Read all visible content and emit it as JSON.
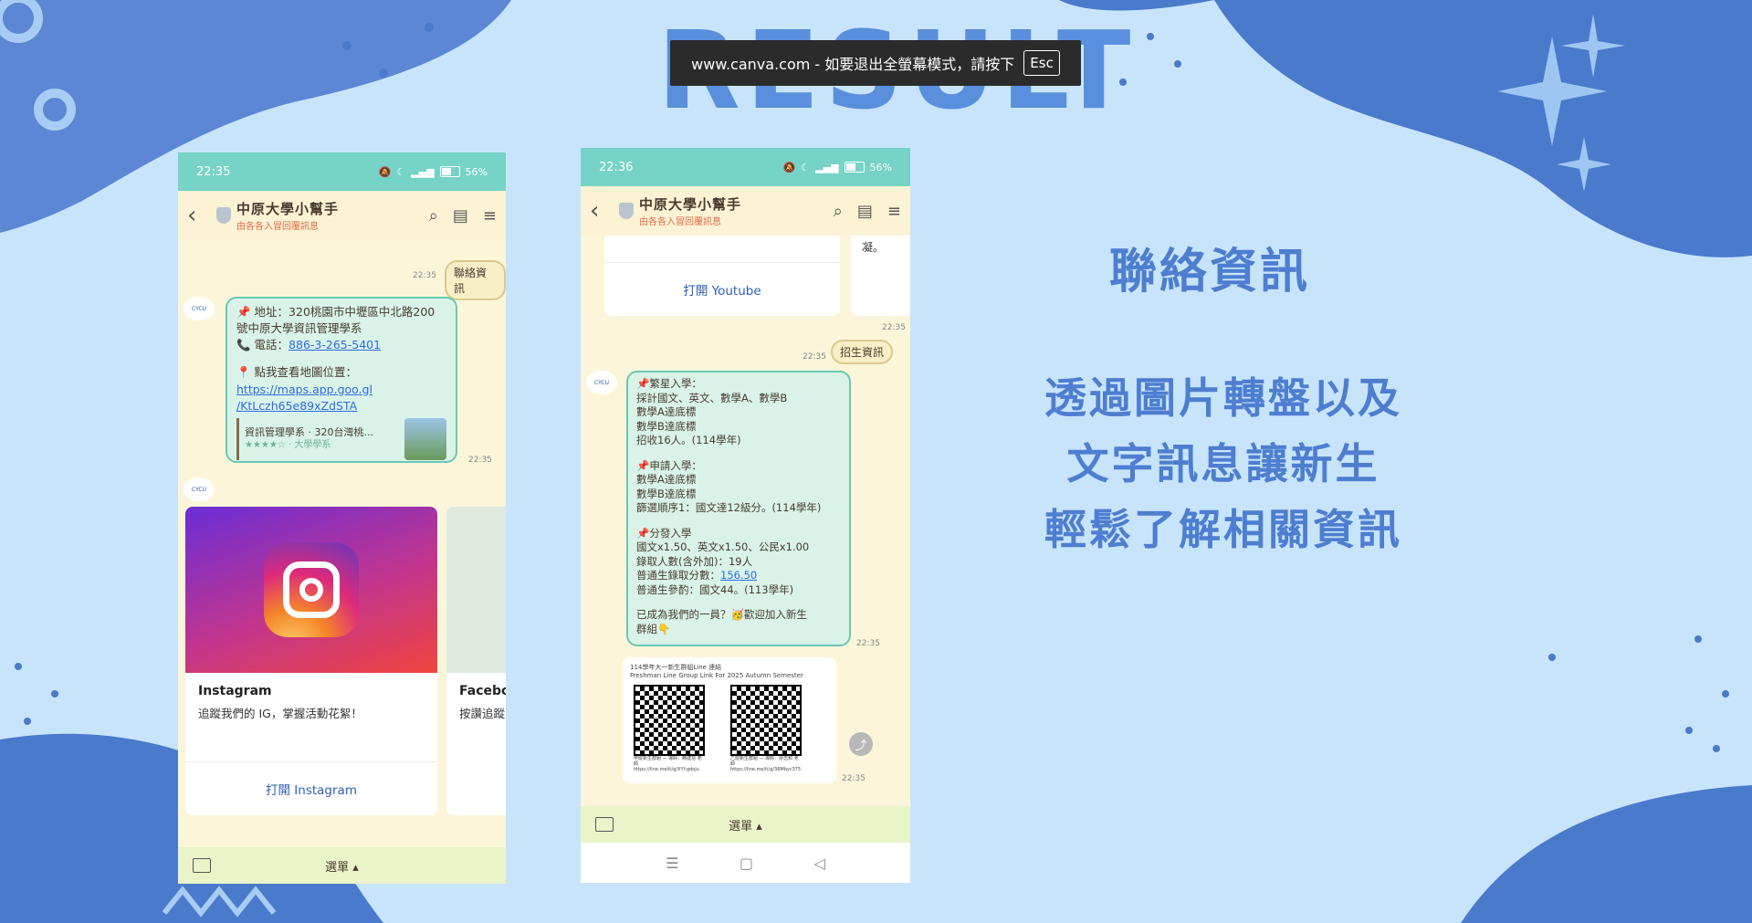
{
  "toast": {
    "text": "www.canva.com - 如要退出全螢幕模式，請按下",
    "key": "Esc"
  },
  "decor": {
    "title_text": "RESULT"
  },
  "right": {
    "title": "聯絡資訊",
    "desc_lines": [
      "透過圖片轉盤以及",
      "文字訊息讓新生",
      "輕鬆了解相關資訊"
    ]
  },
  "phone1": {
    "status_time": "22:35",
    "battery": "56%",
    "header_title": "中原大學小幫手",
    "header_sub": "由各各入冒回覆訊息",
    "tag": "聯絡資訊",
    "tag_time": "22:35",
    "address_line1": "📌 地址：320桃園市中壢區中北路200",
    "address_line2": "號中原大學資訊管理學系",
    "phone_label": "📞 電話：",
    "phone": "886-3-265-5401",
    "map_label": "📍 點我查看地圖位置：",
    "map_link1": "https://maps.app.goo.gl",
    "map_link2": "/KtLczh65e89xZdSTA",
    "map_card_title": "資訊管理學系 · 320台灣桃...",
    "map_card_sub": "★★★★☆ · 大學學系",
    "bubble_time": "22:35",
    "card_title": "Instagram",
    "card_desc": "追蹤我們的 IG，掌握活動花絮！",
    "card_button": "打開 Instagram",
    "card2_title": "Faceboo",
    "card2_desc": "按讚追蹤",
    "menu": "選單 ▴"
  },
  "phone2": {
    "status_time": "22:36",
    "battery": "56%",
    "header_title": "中原大學小幫手",
    "header_sub": "由各各入冒回覆訊息",
    "youtube_button": "打開 Youtube",
    "partial_text": "凝。",
    "top_time": "22:35",
    "tag": "招生資訊",
    "tag_time": "22:35",
    "lines": [
      "📌繁星入學：",
      "採計國文、英文、數學A、數學B",
      "數學A達底標",
      "數學B達底標",
      "招收16人。(114學年)",
      "",
      "📌申請入學：",
      "數學A達底標",
      "數學B達底標",
      "篩選順序1：國文達12級分。(114學年)",
      "",
      "📌分發入學",
      "國文x1.50、英文x1.50、公民x1.00",
      "錄取人數(含外加)：19人",
      "普通生錄取分數：",
      "普通生參酌：國文44。(113學年)",
      "",
      "已成為我們的一員？🥳歡迎加入新生",
      "群組👇"
    ],
    "score": "156.50",
    "bubble_time": "22:35",
    "qr_title1": "114學年大一新生群組Line 連結",
    "qr_title2": "Freshman Line Group Link For 2025 Autumn Semester",
    "qr_a_caption": "甲班新生群組 — 導師：賴建慧 老師",
    "qr_a_link": "https://line.me/ti/g/XYf-gdoju",
    "qr_b_caption": "乙班新生群組 — 導師：廖志和 老師",
    "qr_b_link": "https://line.me/ti/g/36Mbyc375",
    "qr_time": "22:35",
    "menu": "選單 ▴",
    "nav": [
      "☰",
      "▢",
      "◁"
    ]
  }
}
